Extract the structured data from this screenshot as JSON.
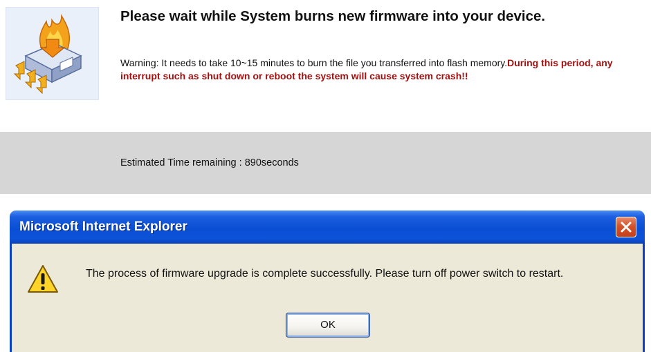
{
  "burn_page": {
    "icon": "firmware-burn-chip-icon",
    "title": "Please wait while System burns new firmware into your device.",
    "warning_normal": "Warning: It needs to take 10~15 minutes to burn the file you transferred into flash memory.",
    "warning_crash": "During this period, any interrupt such as shut down or reboot the system will cause system crash!!",
    "time_label": "Estimated Time remaining : ",
    "time_value": "890seconds"
  },
  "dialog": {
    "title": "Microsoft Internet Explorer",
    "close_icon": "close-icon",
    "warning_icon": "warning-icon",
    "message": "The process of firmware upgrade is complete successfully. Please turn off power switch to restart.",
    "ok_label": "OK"
  },
  "colors": {
    "crash_text": "#a01212",
    "time_band": "#d6d6d6",
    "titlebar": "#0a4ed4",
    "dialog_body": "#ece9d8"
  }
}
